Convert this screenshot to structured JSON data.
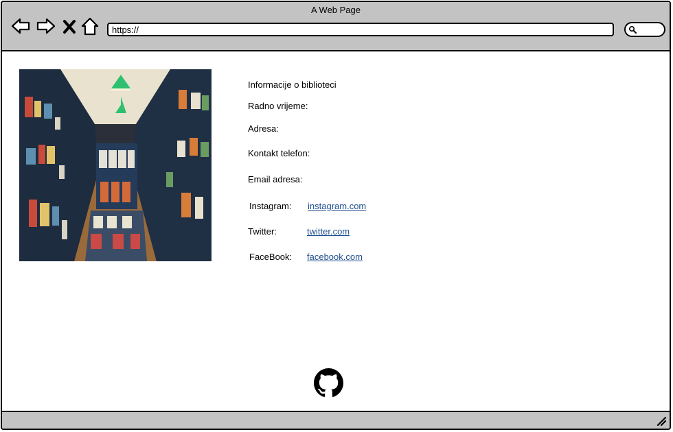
{
  "window": {
    "title": "A Web Page"
  },
  "toolbar": {
    "url": "https://",
    "icons": [
      "back-arrow-icon",
      "forward-arrow-icon",
      "close-icon",
      "home-icon",
      "search-icon"
    ]
  },
  "content": {
    "image_icon": "bookstore-photo",
    "heading": "Informacije o biblioteci",
    "fields": {
      "hours": "Radno vrijeme:",
      "address": "Adresa:",
      "phone": "Kontakt telefon:",
      "email": "Email adresa:"
    },
    "social": [
      {
        "label": "Instagram:",
        "link": "instagram.com"
      },
      {
        "label": "Twitter:",
        "link": "twitter.com"
      },
      {
        "label": "FaceBook:",
        "link": "facebook.com"
      }
    ],
    "footer_icon": "github-icon"
  },
  "colors": {
    "chrome": "#c3c3c3",
    "link": "#1f4e8f",
    "background": "#ffffff"
  }
}
